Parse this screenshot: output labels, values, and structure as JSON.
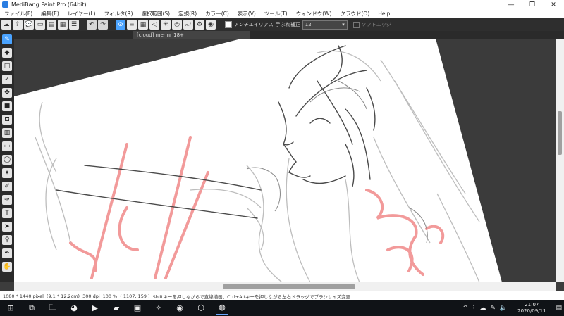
{
  "window": {
    "title": "MediBang Paint Pro (64bit)",
    "controls": [
      "—",
      "❐",
      "✕"
    ]
  },
  "menu": [
    "ファイル(F)",
    "編集(E)",
    "レイヤー(L)",
    "フィルタ(R)",
    "選択範囲(S)",
    "定規(R)",
    "カラー(C)",
    "表示(V)",
    "ツール(T)",
    "ウィンドウ(W)",
    "クラウド(O)",
    "Help"
  ],
  "toolbar": {
    "antialias_label": "アンチエイリアス",
    "stabilizer_label": "手ぶれ補正",
    "stabilizer_value": "12",
    "soft_edge_label": "ソフトエッジ"
  },
  "document_tab": "[cloud] merinr 18+",
  "status": {
    "size": "1080 * 1440 pixel",
    "cm": "(9.1 * 12.2cm)",
    "dpi": "300 dpi",
    "zoom": "100 %",
    "cursor": "( 1107, 159 )",
    "hint": "Shiftキーを押しながらで直線描画、Ctrl+Altキーを押しながら左右ドラッグでブラシサイズ変更"
  },
  "clock": {
    "time": "21:07",
    "date": "2020/09/11"
  },
  "colors": {
    "sketch_line": "#4a4a4a",
    "sketch_light": "#b9b9b9",
    "red_guide": "#f29a9a",
    "accent": "#4aa3ff"
  }
}
